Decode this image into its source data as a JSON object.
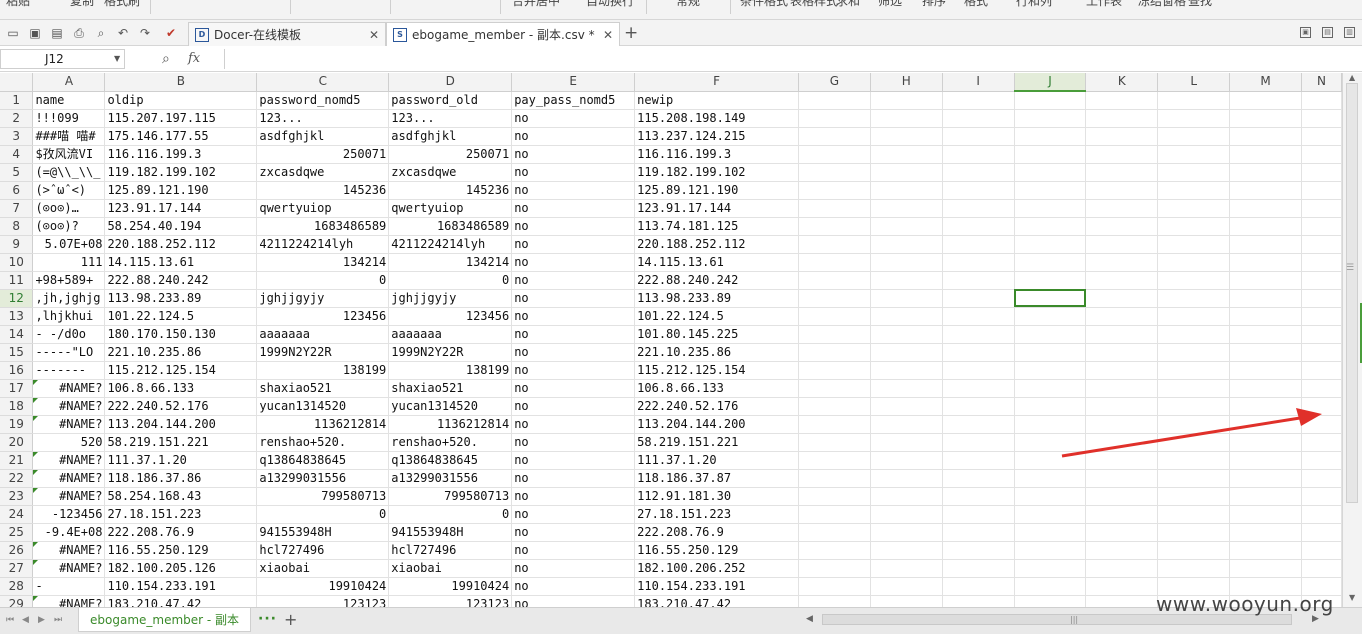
{
  "ribbon": {
    "labels": [
      "粘贴",
      "复制",
      "格式刷",
      "合并居中",
      "自动换行",
      "常规",
      "条件格式",
      "表格样式",
      "求和",
      "筛选",
      "排序",
      "格式",
      "行和列",
      "工作表",
      "冻结窗格",
      "查找"
    ]
  },
  "tabs": [
    {
      "label": "Docer-在线模板",
      "icon": "docer-icon",
      "active": false
    },
    {
      "label": "ebogame_member - 副本.csv *",
      "icon": "spreadsheet-icon",
      "active": true
    }
  ],
  "formula_bar": {
    "cell_ref": "J12",
    "fx": "fx",
    "value": ""
  },
  "active_cell": {
    "row": 12,
    "col": "J"
  },
  "columns": [
    "A",
    "B",
    "C",
    "D",
    "E",
    "F",
    "G",
    "H",
    "I",
    "J",
    "K",
    "L",
    "M",
    "N"
  ],
  "rows": [
    {
      "n": 1,
      "cells": [
        {
          "v": "name"
        },
        {
          "v": "oldip"
        },
        {
          "v": "password_nomd5"
        },
        {
          "v": "password_old"
        },
        {
          "v": "pay_pass_nomd5"
        },
        {
          "v": "newip"
        }
      ]
    },
    {
      "n": 2,
      "cells": [
        {
          "v": "!!!099"
        },
        {
          "v": "115.207.197.115"
        },
        {
          "v": "123..."
        },
        {
          "v": "123..."
        },
        {
          "v": "no"
        },
        {
          "v": "115.208.198.149"
        }
      ]
    },
    {
      "n": 3,
      "cells": [
        {
          "v": "###喵 喵#"
        },
        {
          "v": "175.146.177.55"
        },
        {
          "v": "asdfghjkl"
        },
        {
          "v": "asdfghjkl"
        },
        {
          "v": "no"
        },
        {
          "v": "113.237.124.215"
        }
      ]
    },
    {
      "n": 4,
      "cells": [
        {
          "v": "$孜风流VI"
        },
        {
          "v": "116.116.199.3"
        },
        {
          "v": "250071",
          "t": "num"
        },
        {
          "v": "250071",
          "t": "num"
        },
        {
          "v": "no"
        },
        {
          "v": "116.116.199.3"
        }
      ]
    },
    {
      "n": 5,
      "cells": [
        {
          "v": "(=@\\\\_\\\\_"
        },
        {
          "v": "119.182.199.102"
        },
        {
          "v": "zxcasdqwe"
        },
        {
          "v": "zxcasdqwe"
        },
        {
          "v": "no"
        },
        {
          "v": "119.182.199.102"
        }
      ]
    },
    {
      "n": 6,
      "cells": [
        {
          "v": "(>ˆωˆ<)"
        },
        {
          "v": "125.89.121.190"
        },
        {
          "v": "145236",
          "t": "num"
        },
        {
          "v": "145236",
          "t": "num"
        },
        {
          "v": "no"
        },
        {
          "v": "125.89.121.190"
        }
      ]
    },
    {
      "n": 7,
      "cells": [
        {
          "v": "(⊙o⊙)…"
        },
        {
          "v": "123.91.17.144"
        },
        {
          "v": "qwertyuiop"
        },
        {
          "v": "qwertyuiop"
        },
        {
          "v": "no"
        },
        {
          "v": "123.91.17.144"
        }
      ]
    },
    {
      "n": 8,
      "cells": [
        {
          "v": "(⊙o⊙)?"
        },
        {
          "v": "58.254.40.194"
        },
        {
          "v": "1683486589",
          "t": "num"
        },
        {
          "v": "1683486589",
          "t": "num"
        },
        {
          "v": "no"
        },
        {
          "v": "113.74.181.125"
        }
      ]
    },
    {
      "n": 9,
      "cells": [
        {
          "v": "5.07E+08",
          "t": "num"
        },
        {
          "v": "220.188.252.112"
        },
        {
          "v": "4211224214lyh"
        },
        {
          "v": "4211224214lyh"
        },
        {
          "v": "no"
        },
        {
          "v": "220.188.252.112"
        }
      ]
    },
    {
      "n": 10,
      "cells": [
        {
          "v": "111",
          "t": "num"
        },
        {
          "v": "14.115.13.61"
        },
        {
          "v": "134214",
          "t": "num"
        },
        {
          "v": "134214",
          "t": "num"
        },
        {
          "v": "no"
        },
        {
          "v": "14.115.13.61"
        }
      ]
    },
    {
      "n": 11,
      "cells": [
        {
          "v": "+98+589+"
        },
        {
          "v": "222.88.240.242"
        },
        {
          "v": "0",
          "t": "num"
        },
        {
          "v": "0",
          "t": "num"
        },
        {
          "v": "no"
        },
        {
          "v": "222.88.240.242"
        }
      ]
    },
    {
      "n": 12,
      "cells": [
        {
          "v": ",jh,jghjg"
        },
        {
          "v": "113.98.233.89"
        },
        {
          "v": "jghjjgyjy"
        },
        {
          "v": "jghjjgyjy"
        },
        {
          "v": "no"
        },
        {
          "v": "113.98.233.89"
        }
      ]
    },
    {
      "n": 13,
      "cells": [
        {
          "v": ",lhjkhui"
        },
        {
          "v": "101.22.124.5"
        },
        {
          "v": "123456",
          "t": "num"
        },
        {
          "v": "123456",
          "t": "num"
        },
        {
          "v": "no"
        },
        {
          "v": "101.22.124.5"
        }
      ]
    },
    {
      "n": 14,
      "cells": [
        {
          "v": "- -/d0o"
        },
        {
          "v": "180.170.150.130"
        },
        {
          "v": "aaaaaaa"
        },
        {
          "v": "aaaaaaa"
        },
        {
          "v": "no"
        },
        {
          "v": "101.80.145.225"
        }
      ]
    },
    {
      "n": 15,
      "cells": [
        {
          "v": "-----\"LO"
        },
        {
          "v": "221.10.235.86"
        },
        {
          "v": "1999N2Y22R"
        },
        {
          "v": "1999N2Y22R"
        },
        {
          "v": "no"
        },
        {
          "v": "221.10.235.86"
        }
      ]
    },
    {
      "n": 16,
      "cells": [
        {
          "v": "-------"
        },
        {
          "v": "115.212.125.154"
        },
        {
          "v": "138199",
          "t": "num"
        },
        {
          "v": "138199",
          "t": "num"
        },
        {
          "v": "no"
        },
        {
          "v": "115.212.125.154"
        }
      ]
    },
    {
      "n": 17,
      "cells": [
        {
          "v": "#NAME?",
          "t": "err"
        },
        {
          "v": "106.8.66.133"
        },
        {
          "v": "shaxiao521"
        },
        {
          "v": "shaxiao521"
        },
        {
          "v": "no"
        },
        {
          "v": "106.8.66.133"
        }
      ]
    },
    {
      "n": 18,
      "cells": [
        {
          "v": "#NAME?",
          "t": "err"
        },
        {
          "v": "222.240.52.176"
        },
        {
          "v": "yucan1314520"
        },
        {
          "v": "yucan1314520"
        },
        {
          "v": "no"
        },
        {
          "v": "222.240.52.176"
        }
      ]
    },
    {
      "n": 19,
      "cells": [
        {
          "v": "#NAME?",
          "t": "err"
        },
        {
          "v": "113.204.144.200"
        },
        {
          "v": "1136212814",
          "t": "num"
        },
        {
          "v": "1136212814",
          "t": "num"
        },
        {
          "v": "no"
        },
        {
          "v": "113.204.144.200"
        }
      ]
    },
    {
      "n": 20,
      "cells": [
        {
          "v": "520",
          "t": "num"
        },
        {
          "v": "58.219.151.221"
        },
        {
          "v": "renshao+520."
        },
        {
          "v": "renshao+520."
        },
        {
          "v": "no"
        },
        {
          "v": "58.219.151.221"
        }
      ]
    },
    {
      "n": 21,
      "cells": [
        {
          "v": "#NAME?",
          "t": "err"
        },
        {
          "v": "111.37.1.20"
        },
        {
          "v": "q13864838645"
        },
        {
          "v": "q13864838645"
        },
        {
          "v": "no"
        },
        {
          "v": "111.37.1.20"
        }
      ]
    },
    {
      "n": 22,
      "cells": [
        {
          "v": "#NAME?",
          "t": "err"
        },
        {
          "v": "118.186.37.86"
        },
        {
          "v": "a13299031556"
        },
        {
          "v": "a13299031556"
        },
        {
          "v": "no"
        },
        {
          "v": "118.186.37.87"
        }
      ]
    },
    {
      "n": 23,
      "cells": [
        {
          "v": "#NAME?",
          "t": "err"
        },
        {
          "v": "58.254.168.43"
        },
        {
          "v": "799580713",
          "t": "num"
        },
        {
          "v": "799580713",
          "t": "num"
        },
        {
          "v": "no"
        },
        {
          "v": "112.91.181.30"
        }
      ]
    },
    {
      "n": 24,
      "cells": [
        {
          "v": "-123456",
          "t": "num"
        },
        {
          "v": "27.18.151.223"
        },
        {
          "v": "0",
          "t": "num"
        },
        {
          "v": "0",
          "t": "num"
        },
        {
          "v": "no"
        },
        {
          "v": "27.18.151.223"
        }
      ]
    },
    {
      "n": 25,
      "cells": [
        {
          "v": "-9.4E+08",
          "t": "num"
        },
        {
          "v": "222.208.76.9"
        },
        {
          "v": "941553948H"
        },
        {
          "v": "941553948H"
        },
        {
          "v": "no"
        },
        {
          "v": "222.208.76.9"
        }
      ]
    },
    {
      "n": 26,
      "cells": [
        {
          "v": "#NAME?",
          "t": "err"
        },
        {
          "v": "116.55.250.129"
        },
        {
          "v": "hcl727496"
        },
        {
          "v": "hcl727496"
        },
        {
          "v": "no"
        },
        {
          "v": "116.55.250.129"
        }
      ]
    },
    {
      "n": 27,
      "cells": [
        {
          "v": "#NAME?",
          "t": "err"
        },
        {
          "v": "182.100.205.126"
        },
        {
          "v": "xiaobai"
        },
        {
          "v": "xiaobai"
        },
        {
          "v": "no"
        },
        {
          "v": "182.100.206.252"
        }
      ]
    },
    {
      "n": 28,
      "cells": [
        {
          "v": "-"
        },
        {
          "v": "110.154.233.191"
        },
        {
          "v": "19910424",
          "t": "num"
        },
        {
          "v": "19910424",
          "t": "num"
        },
        {
          "v": "no"
        },
        {
          "v": "110.154.233.191"
        }
      ]
    },
    {
      "n": 29,
      "cells": [
        {
          "v": "#NAME?",
          "t": "err"
        },
        {
          "v": "183.210.47.42"
        },
        {
          "v": "123123",
          "t": "num"
        },
        {
          "v": "123123",
          "t": "num"
        },
        {
          "v": "no"
        },
        {
          "v": "183.210.47.42"
        }
      ]
    }
  ],
  "sheet_tab": {
    "label": "ebogame_member - 副本"
  },
  "watermark": "www.wooyun.org",
  "colors": {
    "accent": "#3a8a2a",
    "arrow": "#e0302a"
  }
}
